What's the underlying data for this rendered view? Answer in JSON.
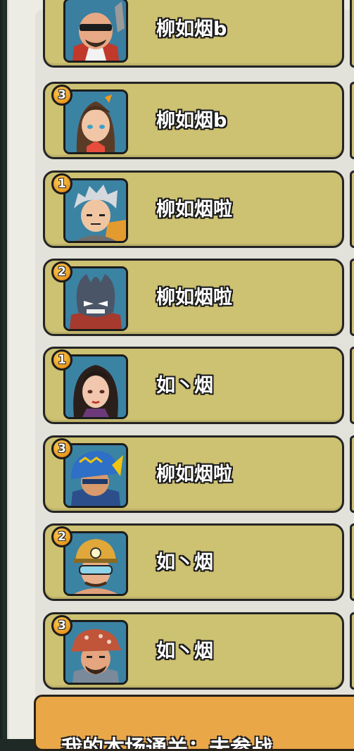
{
  "rows": [
    {
      "name": "柳如烟b",
      "badge": "",
      "avatar": "sunglasses-boss-avatar"
    },
    {
      "name": "柳如烟b",
      "badge": "3",
      "avatar": "ponytail-girl-avatar"
    },
    {
      "name": "柳如烟啦",
      "badge": "1",
      "avatar": "silver-hair-boy-avatar"
    },
    {
      "name": "柳如烟啦",
      "badge": "2",
      "avatar": "masked-bandit-avatar"
    },
    {
      "name": "如丶烟",
      "badge": "1",
      "avatar": "dark-hair-woman-avatar"
    },
    {
      "name": "柳如烟啦",
      "badge": "3",
      "avatar": "blue-helmet-knight-avatar"
    },
    {
      "name": "如丶烟",
      "badge": "2",
      "avatar": "miner-goggles-avatar"
    },
    {
      "name": "如丶烟",
      "badge": "3",
      "avatar": "bandana-man-avatar"
    }
  ],
  "bottom": {
    "text": "我的本场通关：未参战"
  },
  "colors": {
    "row_bg": "#cdc172",
    "badge": "#f0a52a",
    "bottom_panel": "#e9a748"
  }
}
